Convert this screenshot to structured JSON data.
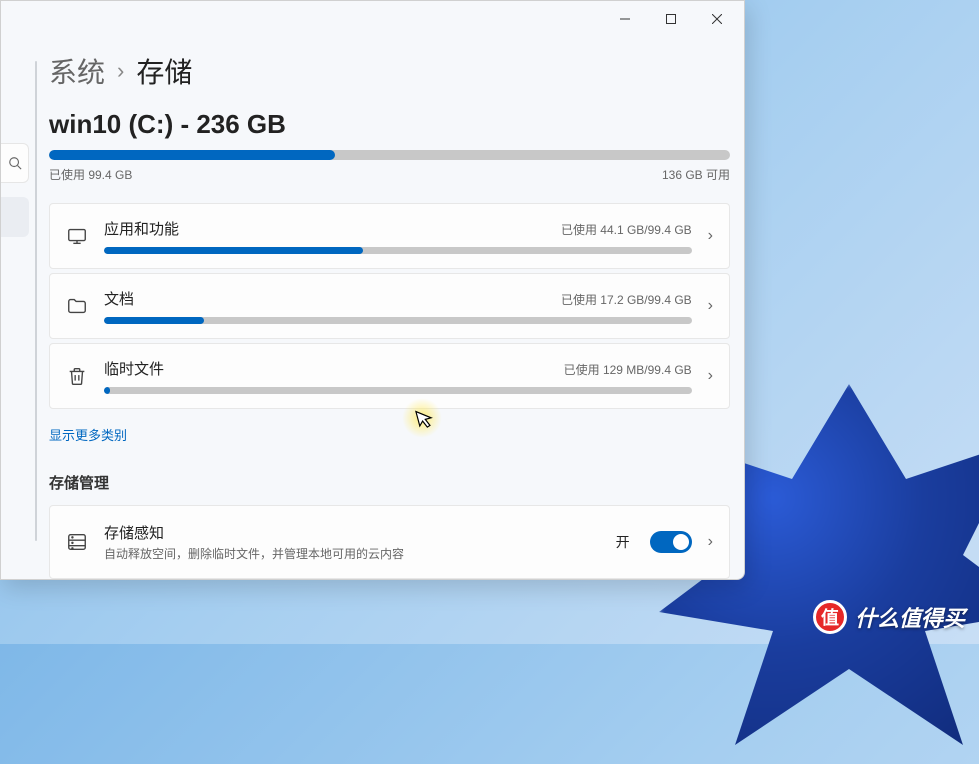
{
  "breadcrumb": {
    "parent": "系统",
    "current": "存储"
  },
  "drive": {
    "title": "win10 (C:) - 236 GB",
    "used_label": "已使用 99.4 GB",
    "free_label": "136 GB 可用",
    "fill_percent": 42
  },
  "categories": [
    {
      "icon": "apps",
      "name": "应用和功能",
      "usage": "已使用 44.1 GB/99.4 GB",
      "percent": 44
    },
    {
      "icon": "docs",
      "name": "文档",
      "usage": "已使用 17.2 GB/99.4 GB",
      "percent": 17
    },
    {
      "icon": "trash",
      "name": "临时文件",
      "usage": "已使用 129 MB/99.4 GB",
      "percent": 1
    }
  ],
  "show_more": "显示更多类别",
  "mgmt_section": "存储管理",
  "storage_sense": {
    "title": "存储感知",
    "desc": "自动释放空间，删除临时文件，并管理本地可用的云内容",
    "toggle_label": "开",
    "on": true
  },
  "watermark": {
    "badge": "值",
    "text": "什么值得买"
  }
}
